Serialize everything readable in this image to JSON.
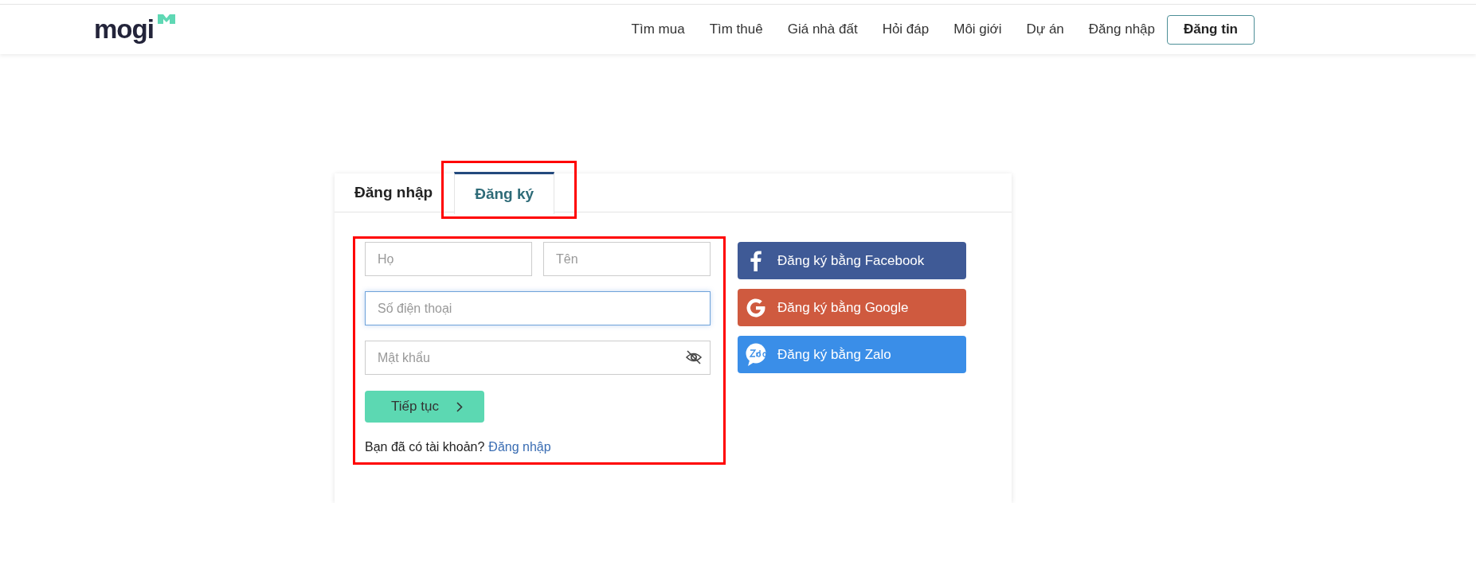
{
  "header": {
    "logo": "mogi",
    "nav": [
      {
        "label": "Tìm mua"
      },
      {
        "label": "Tìm thuê"
      },
      {
        "label": "Giá nhà đất"
      },
      {
        "label": "Hỏi đáp"
      },
      {
        "label": "Môi giới"
      },
      {
        "label": "Dự án"
      },
      {
        "label": "Đăng nhập"
      }
    ],
    "post_button": "Đăng tin"
  },
  "card": {
    "tabs": [
      {
        "label": "Đăng nhập",
        "selected": false,
        "highlighted": false
      },
      {
        "label": "Đăng ký",
        "selected": true,
        "highlighted": true
      }
    ],
    "form": {
      "highlighted": true,
      "name_fields": [
        {
          "placeholder": "Họ",
          "focused": false
        },
        {
          "placeholder": "Tên",
          "focused": false
        }
      ],
      "phone_field": {
        "placeholder": "Số điện thoại",
        "focused": true
      },
      "password_field": {
        "placeholder": "Mật khẩu",
        "focused": false
      },
      "continue_button": "Tiếp tục",
      "login_prompt": "Bạn đã có tài khoản?",
      "login_link": "Đăng nhập"
    },
    "social_buttons": [
      {
        "kind": "facebook",
        "label": "Đăng ký bằng Facebook",
        "color": "#3f5a96"
      },
      {
        "kind": "google",
        "label": "Đăng ký bằng Google",
        "color": "#cf5a3f"
      },
      {
        "kind": "zalo",
        "label": "Đăng ký bằng Zalo",
        "color": "#3a8ee8"
      }
    ]
  }
}
